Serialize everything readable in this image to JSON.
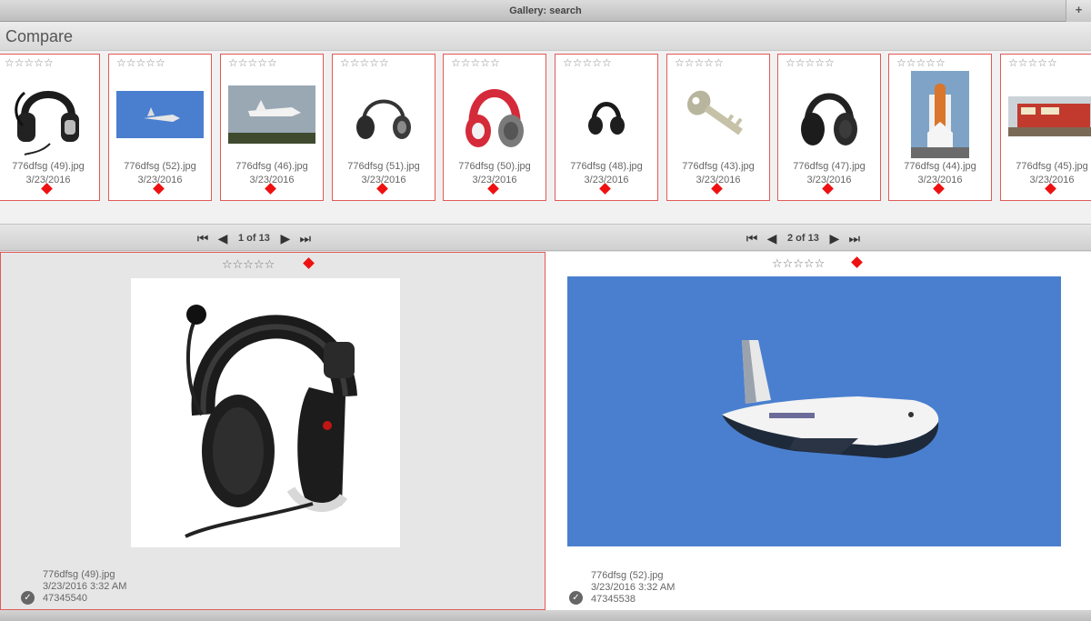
{
  "window": {
    "title": "Gallery: search",
    "corner_icon": "plus-icon"
  },
  "header": {
    "title": "Compare"
  },
  "stars_glyph": "☆☆☆☆☆",
  "thumbnails": [
    {
      "name": "776dfsg (49).jpg",
      "date": "3/23/2016",
      "image": "headset-image"
    },
    {
      "name": "776dfsg (52).jpg",
      "date": "3/23/2016",
      "image": "space-shuttle-image"
    },
    {
      "name": "776dfsg (46).jpg",
      "date": "3/23/2016",
      "image": "shuttle-landing-image"
    },
    {
      "name": "776dfsg (51).jpg",
      "date": "3/23/2016",
      "image": "headphones-image"
    },
    {
      "name": "776dfsg (50).jpg",
      "date": "3/23/2016",
      "image": "red-headphones-image"
    },
    {
      "name": "776dfsg (48).jpg",
      "date": "3/23/2016",
      "image": "black-headphones-image"
    },
    {
      "name": "776dfsg (43).jpg",
      "date": "3/23/2016",
      "image": "key-image"
    },
    {
      "name": "776dfsg (47).jpg",
      "date": "3/23/2016",
      "image": "over-ear-headphones-image"
    },
    {
      "name": "776dfsg (44).jpg",
      "date": "3/23/2016",
      "image": "shuttle-launchpad-image"
    },
    {
      "name": "776dfsg (45).jpg",
      "date": "3/23/2016",
      "image": "train-image"
    }
  ],
  "left_nav": {
    "page": "1 of 13"
  },
  "right_nav": {
    "page": "2 of 13"
  },
  "left_panel": {
    "name": "776dfsg (49).jpg",
    "datetime": "3/23/2016 3:32 AM",
    "size": "47345540"
  },
  "right_panel": {
    "name": "776dfsg (52).jpg",
    "datetime": "3/23/2016 3:32 AM",
    "size": "47345538"
  },
  "colors": {
    "flag": "#ee1111",
    "border": "#e05a5a",
    "sky": "#4a7fcf"
  }
}
